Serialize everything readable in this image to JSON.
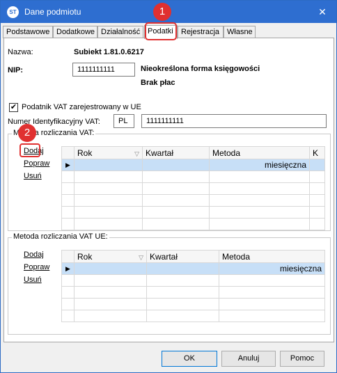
{
  "window": {
    "title": "Dane podmiotu",
    "app_icon_text": "ST",
    "close_glyph": "✕"
  },
  "tabs": [
    "Podstawowe",
    "Dodatkowe",
    "Działalność",
    "Podatki",
    "Rejestracja",
    "Własne"
  ],
  "header": {
    "nazwa_label": "Nazwa:",
    "nazwa_value": "Subiekt 1.81.0.6217",
    "nip_label": "NIP:",
    "nip_value": "1111111111",
    "forma_text": "Nieokreślona forma księgowości",
    "placa_text": "Brak płac"
  },
  "vat_ue": {
    "checkbox_label": "Podatnik VAT zarejestrowany w UE",
    "checkbox_checked": true,
    "check_glyph": "✔",
    "numer_label": "Numer Identyfikacyjny VAT:",
    "country_code": "PL",
    "numer_value": "1111111111"
  },
  "vat_group": {
    "title": "Metoda rozliczania VAT:",
    "actions": {
      "add": "Dodaj",
      "edit": "Popraw",
      "delete": "Usuń"
    },
    "columns": [
      "Rok",
      "Kwartał",
      "Metoda",
      "K"
    ],
    "row_marker": "▶",
    "sort_glyph": "▽",
    "rows": [
      {
        "rok": "",
        "kwartal": "",
        "metoda": "miesięczna"
      }
    ]
  },
  "vat_ue_group": {
    "title": "Metoda rozliczania VAT UE:",
    "actions": {
      "add": "Dodaj",
      "edit": "Popraw",
      "delete": "Usuń"
    },
    "columns": [
      "Rok",
      "Kwartał",
      "Metoda"
    ],
    "row_marker": "▶",
    "sort_glyph": "▽",
    "rows": [
      {
        "rok": "",
        "kwartal": "",
        "metoda": "miesięczna"
      }
    ]
  },
  "badges": [
    "1",
    "2"
  ],
  "buttons": {
    "ok": "OK",
    "cancel": "Anuluj",
    "help": "Pomoc"
  },
  "colors": {
    "titlebar": "#2e6ed0",
    "highlight": "#e03030",
    "selected_row": "#c7dff7"
  }
}
